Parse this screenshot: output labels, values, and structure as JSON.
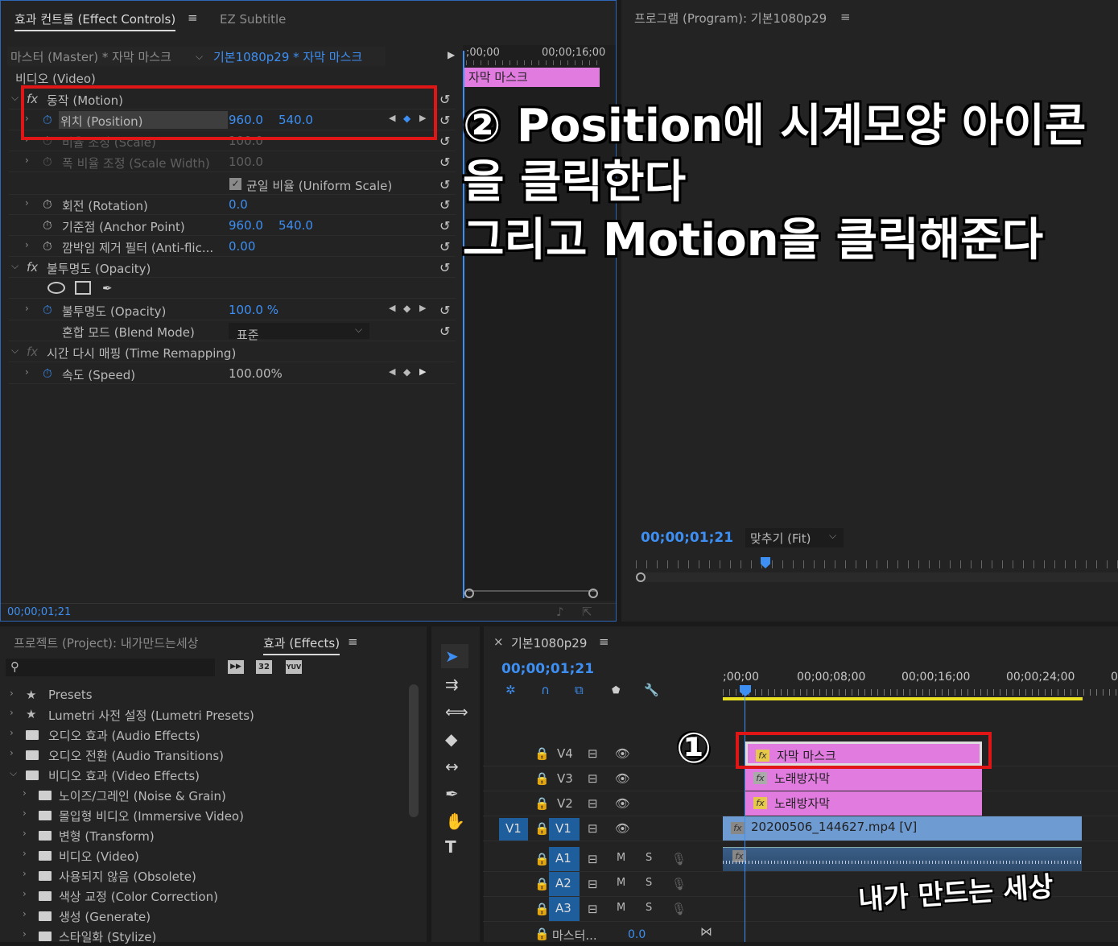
{
  "effect_controls": {
    "tab_active": "효과 컨트롤 (Effect Controls)",
    "tab_other": "EZ Subtitle",
    "menu_icon": "≡",
    "master_label": "마스터 (Master) * 자막 마스크",
    "sequence_label": "기본1080p29 * 자막 마스크",
    "ruler_start": ";00;00",
    "ruler_end": "00;00;16;00",
    "clip_name": "자막 마스크",
    "video_header": "비디오 (Video)",
    "rows": [
      {
        "label": "동작 (Motion)"
      },
      {
        "label": "위치 (Position)",
        "v1": "960.0",
        "v2": "540.0"
      },
      {
        "label": "비율 조정 (Scale)",
        "v1": "100.0"
      },
      {
        "label": "폭 비율 조정 (Scale Width)",
        "v1": "100.0"
      },
      {
        "label": "균일 비율 (Uniform Scale)"
      },
      {
        "label": "회전 (Rotation)",
        "v1": "0.0"
      },
      {
        "label": "기준점 (Anchor Point)",
        "v1": "960.0",
        "v2": "540.0"
      },
      {
        "label": "깜박임 제거 필터 (Anti-flic...",
        "v1": "0.00"
      },
      {
        "label": "불투명도 (Opacity)"
      },
      {
        "label": "불투명도 (Opacity)",
        "v1": "100.0 %"
      },
      {
        "label": "혼합 모드 (Blend Mode)",
        "v1": "표준"
      },
      {
        "label": "시간 다시 매핑 (Time Remapping)"
      },
      {
        "label": "속도 (Speed)",
        "v1": "100.00%"
      }
    ],
    "timecode": "00;00;01;21"
  },
  "program": {
    "title": "프로그램 (Program): 기본1080p29",
    "timecode": "00;00;01;21",
    "fit": "맞추기 (Fit)"
  },
  "annotation": {
    "line1": "② Position에 시계모양 아이콘",
    "line2": "을 클릭한다",
    "line3": "그리고 Motion을 클릭해준다",
    "circle1": "①",
    "watermark": "내가 만드는 세상"
  },
  "project": {
    "tab_project": "프로젝트 (Project): 내가만드는세상",
    "tab_effects": "효과 (Effects)",
    "search_placeholder": "",
    "items": [
      "Presets",
      "Lumetri 사전 설정 (Lumetri Presets)",
      "오디오 효과 (Audio Effects)",
      "오디오 전환 (Audio Transitions)",
      "비디오 효과 (Video Effects)",
      "노이즈/그레인 (Noise & Grain)",
      "몰입형 비디오 (Immersive Video)",
      "변형 (Transform)",
      "비디오 (Video)",
      "사용되지 않음 (Obsolete)",
      "색상 교정 (Color Correction)",
      "생성 (Generate)",
      "스타일화 (Stylize)"
    ]
  },
  "timeline": {
    "title": "기본1080p29",
    "close": "×",
    "timecode": "00;00;01;21",
    "ruler": [
      ";00;00",
      "00;00;08;00",
      "00;00;16;00",
      "00;00;24;00",
      "0"
    ],
    "tracks": [
      "V4",
      "V3",
      "V2",
      "V1",
      "A1",
      "A2",
      "A3"
    ],
    "source_v": "V1",
    "master": "마스터...",
    "master_val": "0.0",
    "clips": {
      "v4": "자막 마스크",
      "v3": "노래방자막",
      "v2": "노래방자막",
      "v1": "20200506_144627.mp4 [V]"
    },
    "m": "M",
    "s": "S"
  }
}
